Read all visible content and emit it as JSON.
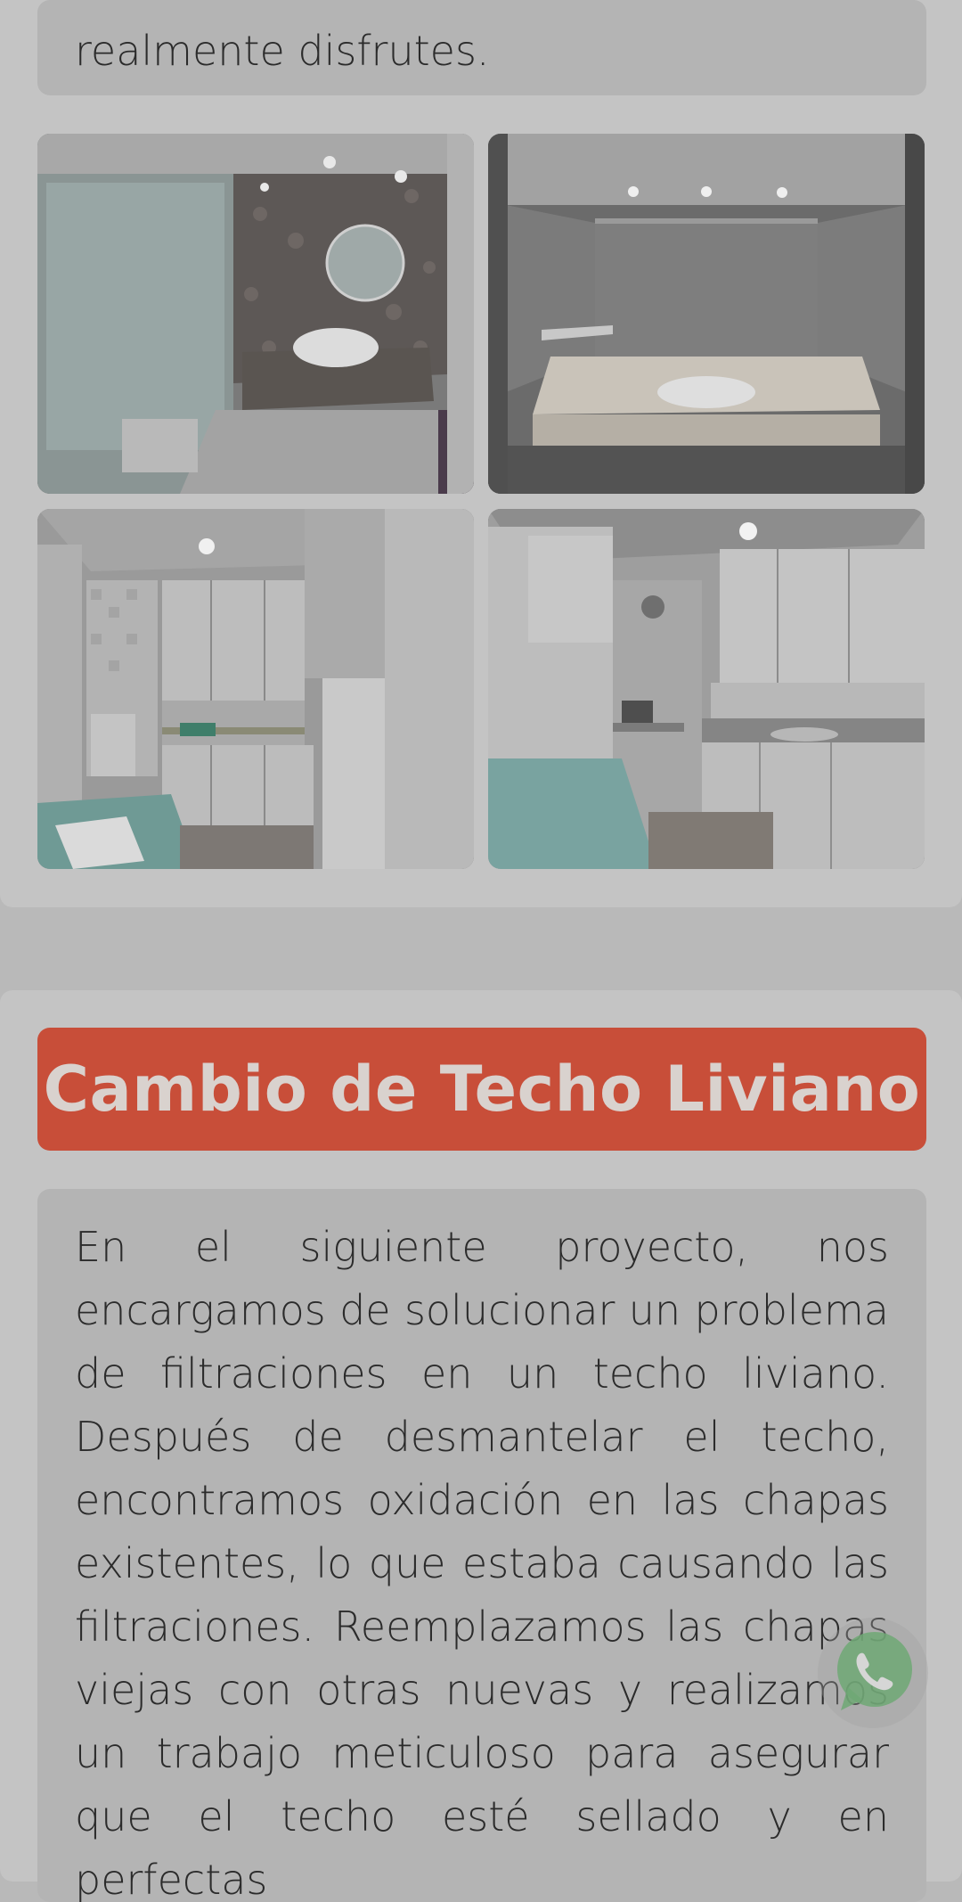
{
  "top_section": {
    "intro_text_tail": "realmente disfrutes.",
    "gallery": [
      {
        "icon": "bathroom-mosaic-photo"
      },
      {
        "icon": "bathroom-vanity-photo"
      },
      {
        "icon": "kitchen-fridge-photo"
      },
      {
        "icon": "kitchen-counter-photo"
      }
    ]
  },
  "project": {
    "title": "Cambio de Techo Liviano",
    "description": "En el siguiente proyecto, nos encargamos de solucionar un problema de filtraciones en un techo liviano. Después de desmantelar el techo, encontramos oxidación en las chapas existentes, lo que estaba causando las filtraciones. Reemplazamos las chapas viejas con otras nuevas y realizamos un trabajo meticuloso para asegurar que el techo esté sellado y en perfectas"
  },
  "floating": {
    "whatsapp_icon": "whatsapp-icon",
    "color": "#6fa874"
  }
}
